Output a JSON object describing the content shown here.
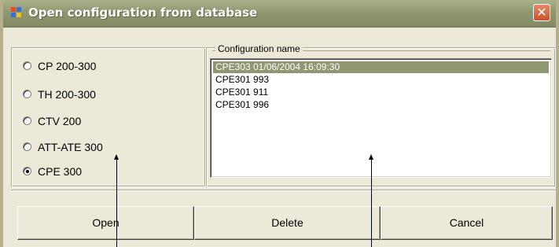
{
  "window": {
    "title": "Open configuration from database",
    "close_symbol": "✕",
    "icon": "app-window-icon",
    "accent_color": "#8f9870",
    "close_color": "#d5643f"
  },
  "radio_options": [
    {
      "label": "CP 200-300",
      "checked": false
    },
    {
      "label": "TH 200-300",
      "checked": false
    },
    {
      "label": "CTV 200",
      "checked": false
    },
    {
      "label": "ATT-ATE 300",
      "checked": false
    },
    {
      "label": "CPE 300",
      "checked": true
    }
  ],
  "configuration": {
    "group_label": "Configuration name",
    "items": [
      {
        "text": "CPE303 01/06/2004 16:09:30",
        "selected": true
      },
      {
        "text": "CPE301 993",
        "selected": false
      },
      {
        "text": "CPE301 911",
        "selected": false
      },
      {
        "text": "CPE301 996",
        "selected": false
      }
    ]
  },
  "buttons": {
    "open": "Open",
    "delete": "Delete",
    "cancel": "Cancel"
  }
}
